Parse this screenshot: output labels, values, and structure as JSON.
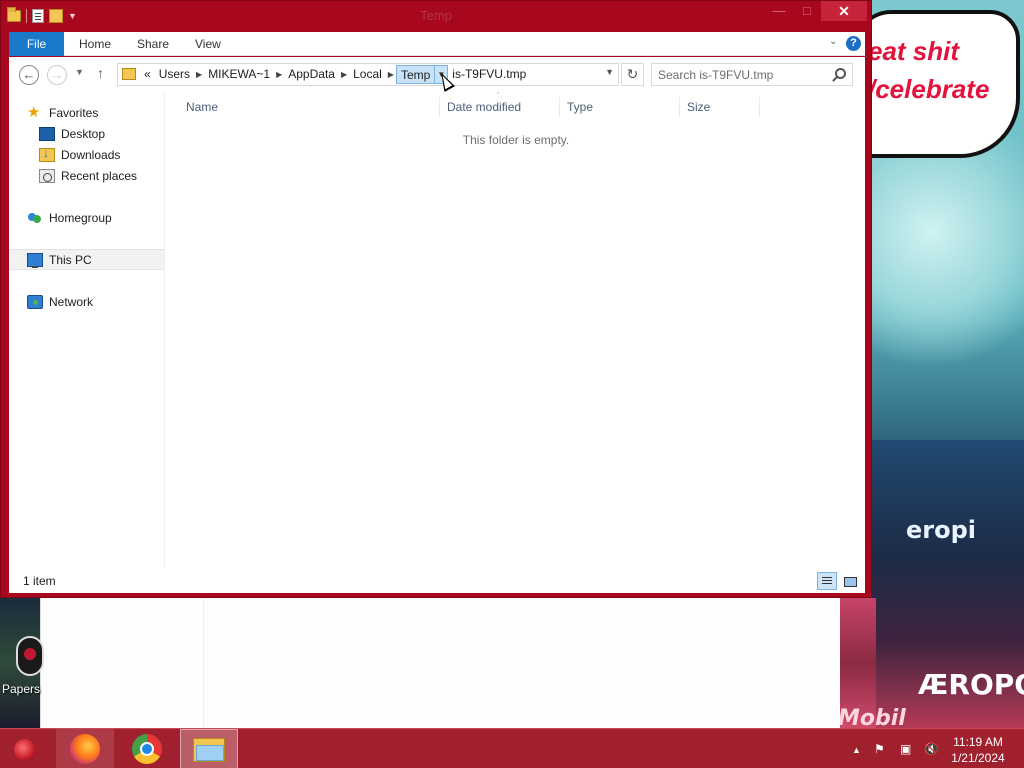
{
  "window": {
    "title": "Temp"
  },
  "ribbon": {
    "file": "File",
    "home": "Home",
    "share": "Share",
    "view": "View"
  },
  "address": {
    "overflow": "«",
    "crumbs": [
      "Users",
      "MIKEWA~1",
      "AppData",
      "Local",
      "Temp",
      "is-T9FVU.tmp"
    ]
  },
  "search": {
    "placeholder": "Search is-T9FVU.tmp"
  },
  "navpane": {
    "favorites": "Favorites",
    "desktop": "Desktop",
    "downloads": "Downloads",
    "recent": "Recent places",
    "homegroup": "Homegroup",
    "thispc": "This PC",
    "network": "Network"
  },
  "columns": {
    "name": "Name",
    "date": "Date modified",
    "type": "Type",
    "size": "Size"
  },
  "filelist": {
    "empty": "This folder is empty."
  },
  "status": {
    "count": "1 item"
  },
  "desktop_icons": [
    {
      "label": "Papers"
    }
  ],
  "wallpaper": {
    "line1": "eat shit",
    "line2": "/celebrate",
    "sign1": "eropi",
    "sign2": "ÆROPOS",
    "sign3": "Mobil"
  },
  "taskbar": {
    "apps": [
      "firefox-icon",
      "chrome-icon",
      "file-explorer-icon"
    ],
    "time": "11:19 AM",
    "date": "1/21/2024"
  },
  "colors": {
    "accent": "#a7081e",
    "file_tab": "#1979ca",
    "crumb_highlight": "#c8e3f8"
  }
}
